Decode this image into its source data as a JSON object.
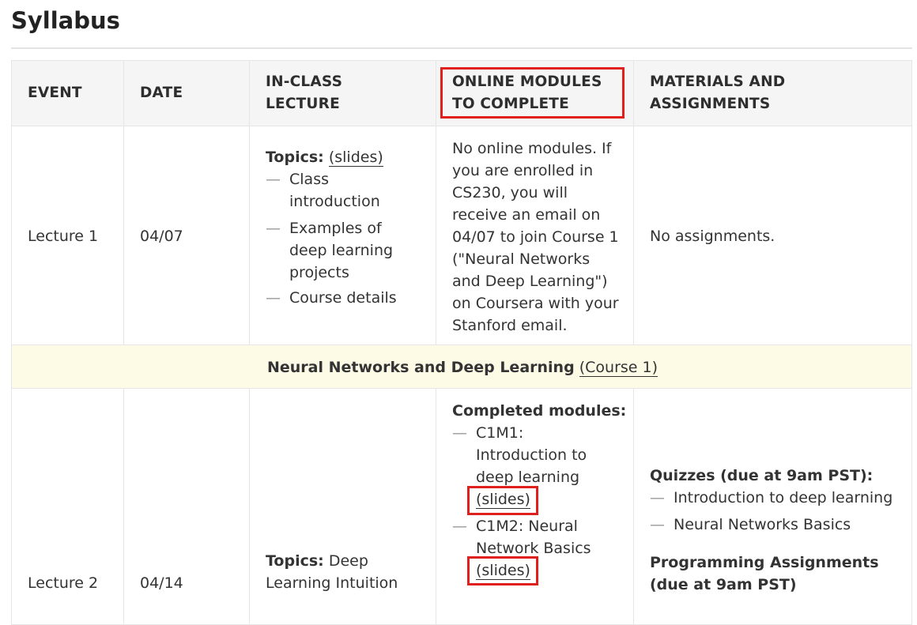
{
  "page_title": "Syllabus",
  "headers": {
    "event": "EVENT",
    "date": "DATE",
    "lecture_line1": "IN-CLASS",
    "lecture_line2": "LECTURE",
    "online_line1": "ONLINE MODULES",
    "online_line2": "TO COMPLETE",
    "materials_line1": "MATERIALS AND",
    "materials_line2": "ASSIGNMENTS"
  },
  "row1": {
    "event": "Lecture 1",
    "date": "04/07",
    "topics_label": "Topics:",
    "slides_link": "(slides)",
    "topics": [
      "Class introduction",
      "Examples of deep learning projects",
      "Course details"
    ],
    "online": "No online modules. If you are enrolled in CS230, you will receive an email on 04/07 to join Course 1 (\"Neural Networks and Deep Learning\") on Coursera with your Stanford email.",
    "materials": "No assignments."
  },
  "section": {
    "title": "Neural Networks and Deep Learning",
    "link": "(Course 1)"
  },
  "row2": {
    "event": "Lecture 2",
    "date": "04/14",
    "topics_label": "Topics:",
    "topics_text": "Deep Learning Intuition",
    "completed_label": "Completed modules:",
    "modules": [
      {
        "text": "C1M1: Introduction to deep learning",
        "link": "(slides)"
      },
      {
        "text": "C1M2: Neural Network Basics",
        "link": "(slides)"
      }
    ],
    "quizzes_label": "Quizzes (due at 9am PST):",
    "quizzes": [
      "Introduction to deep learning",
      "Neural Networks Basics"
    ],
    "prog_label_line1": "Programming Assignments",
    "prog_label_line2": "(due at 9am PST)"
  },
  "colors": {
    "highlight_box": "#e0201c",
    "header_bg": "#f5f5f5",
    "section_bg": "#fdfbe6"
  }
}
